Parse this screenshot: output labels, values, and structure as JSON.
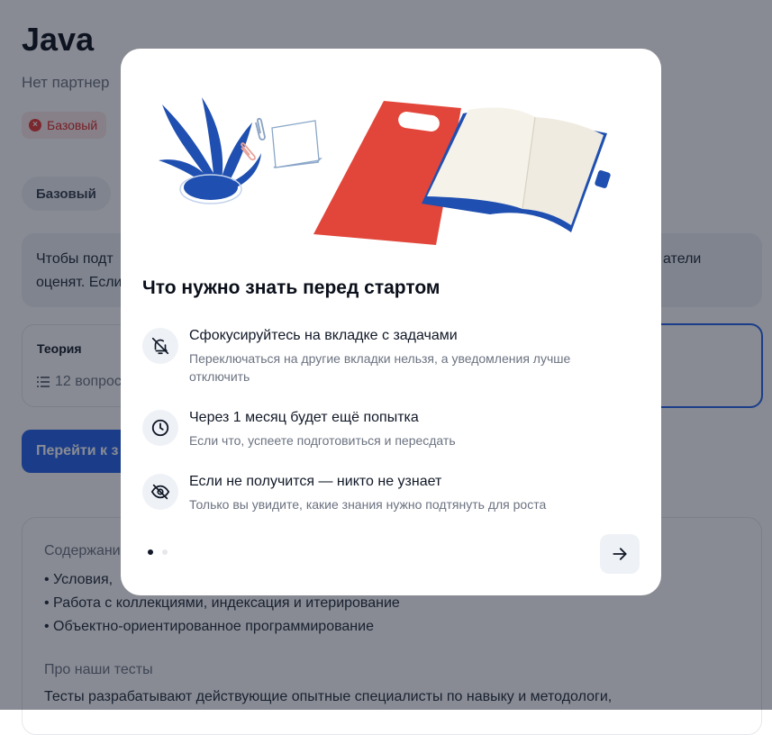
{
  "page": {
    "title": "Java",
    "subtitle": "Нет партнер",
    "level_badge": "Базовый",
    "level_chip": "Базовый",
    "info_line1": "Чтобы подт",
    "info_line2": "оценят. Если",
    "info_line1_right": "атели",
    "theory_card": {
      "title": "Теория",
      "questions": "12 вопрос"
    },
    "go_button": "Перейти к з",
    "contents": {
      "heading": "Содержани",
      "items": [
        "Условия,",
        "Работа с коллекциями, индексация и итерирование",
        "Объектно-ориентированное программирование"
      ],
      "about_heading": "Про наши тесты",
      "about_text": "Тесты разрабатывают действующие опытные специалисты по навыку и методологи,"
    }
  },
  "modal": {
    "title": "Что нужно знать перед стартом",
    "tips": [
      {
        "icon": "bell-off-icon",
        "title": "Сфокусируйтесь на вкладке с задачами",
        "description": "Переключаться на другие вкладки нельзя, а уведомления лучше отключить"
      },
      {
        "icon": "clock-icon",
        "title": "Через 1 месяц будет ещё попытка",
        "description": "Если что, успеете подготовиться и пересдать"
      },
      {
        "icon": "eye-off-icon",
        "title": "Если не получится — никто не узнает",
        "description": "Только вы увидите, какие знания нужно подтянуть для роста"
      }
    ],
    "pagination": {
      "current": 1,
      "total": 2
    },
    "next_icon": "arrow-right-icon"
  },
  "colors": {
    "primary": "#2563eb",
    "overlay": "#111827",
    "illustration_red": "#e2463a",
    "illustration_blue": "#1f4fb0"
  }
}
